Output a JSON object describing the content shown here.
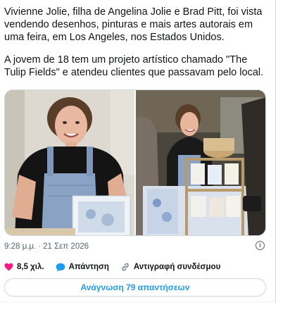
{
  "tweet": {
    "paragraphs": [
      "Vivienne Jolie, filha de Angelina Jolie e Brad Pitt, foi vista\nvendendo desenhos, pinturas e mais artes autorais em\numa feira, em Los Angeles, nos Estados Unidos.",
      "A jovem de 18 tem um projeto artístico chamado \"The\nTulip Fields\" e atendeu clientes que passavam pelo local."
    ],
    "time": "9:28 μ.μ.",
    "separator": "·",
    "date": "21 Σεπ 2026",
    "info_icon": "info-icon",
    "actions": {
      "like_icon": "heart-icon",
      "like_count": "8,5 χιλ.",
      "reply_icon": "speech-bubble-icon",
      "reply_label": "Απάντηση",
      "copy_icon": "link-icon",
      "copy_label": "Αντιγραφή συνδέσμου"
    },
    "read_replies_label": "Ανάγνωση 79 απαντήσεων"
  },
  "colors": {
    "text": "#0f1419",
    "muted": "#536471",
    "accent": "#1d9bf0",
    "like": "#f91880",
    "border": "#cfd9de"
  }
}
